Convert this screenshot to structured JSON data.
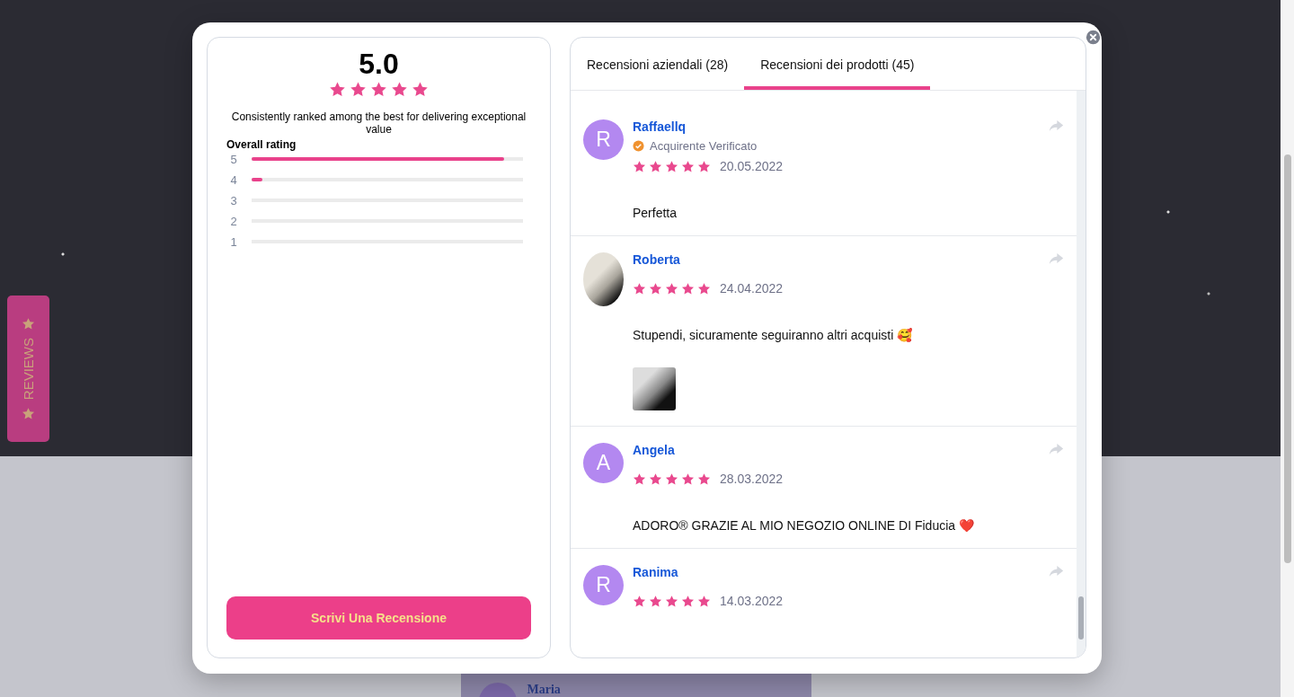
{
  "side_tab": {
    "label": "REVIEWS"
  },
  "summary": {
    "score": "5.0",
    "stars": 5,
    "tagline": "Consistently ranked among the best for delivering exceptional value",
    "overall_label": "Overall rating",
    "bars": [
      {
        "label": "5",
        "level": 0.93
      },
      {
        "label": "4",
        "level": 0.04
      },
      {
        "label": "3"
      },
      {
        "label": "2"
      },
      {
        "label": "1"
      }
    ],
    "write_button": "Scrivi Una Recensione"
  },
  "tabs": [
    {
      "label": "Recensioni aziendali (28)",
      "selected": false
    },
    {
      "label": "Recensioni dei prodotti (45)",
      "selected": true
    }
  ],
  "reviews": [
    {
      "name": "Raffaellq",
      "initial": "R",
      "verified": true,
      "verified_label": "Acquirente Verificato",
      "stars": 5,
      "date": "20.05.2022",
      "text": "Perfetta",
      "has_photo": false
    },
    {
      "name": "Roberta",
      "verified": false,
      "stars": 5,
      "date": "24.04.2022",
      "text": "Stupendi, sicuramente seguiranno altri acquisti 🥰",
      "has_photo": true
    },
    {
      "name": "Angela",
      "initial": "A",
      "verified": false,
      "stars": 5,
      "date": "28.03.2022",
      "text": "ADORO® GRAZIE AL MIO NEGOZIO ONLINE DI Fiducia ❤️",
      "has_photo": false
    },
    {
      "name": "Ranima",
      "initial": "R",
      "verified": false,
      "stars": 5,
      "date": "14.03.2022",
      "has_photo": false
    }
  ],
  "background_card": {
    "name": "Maria"
  }
}
